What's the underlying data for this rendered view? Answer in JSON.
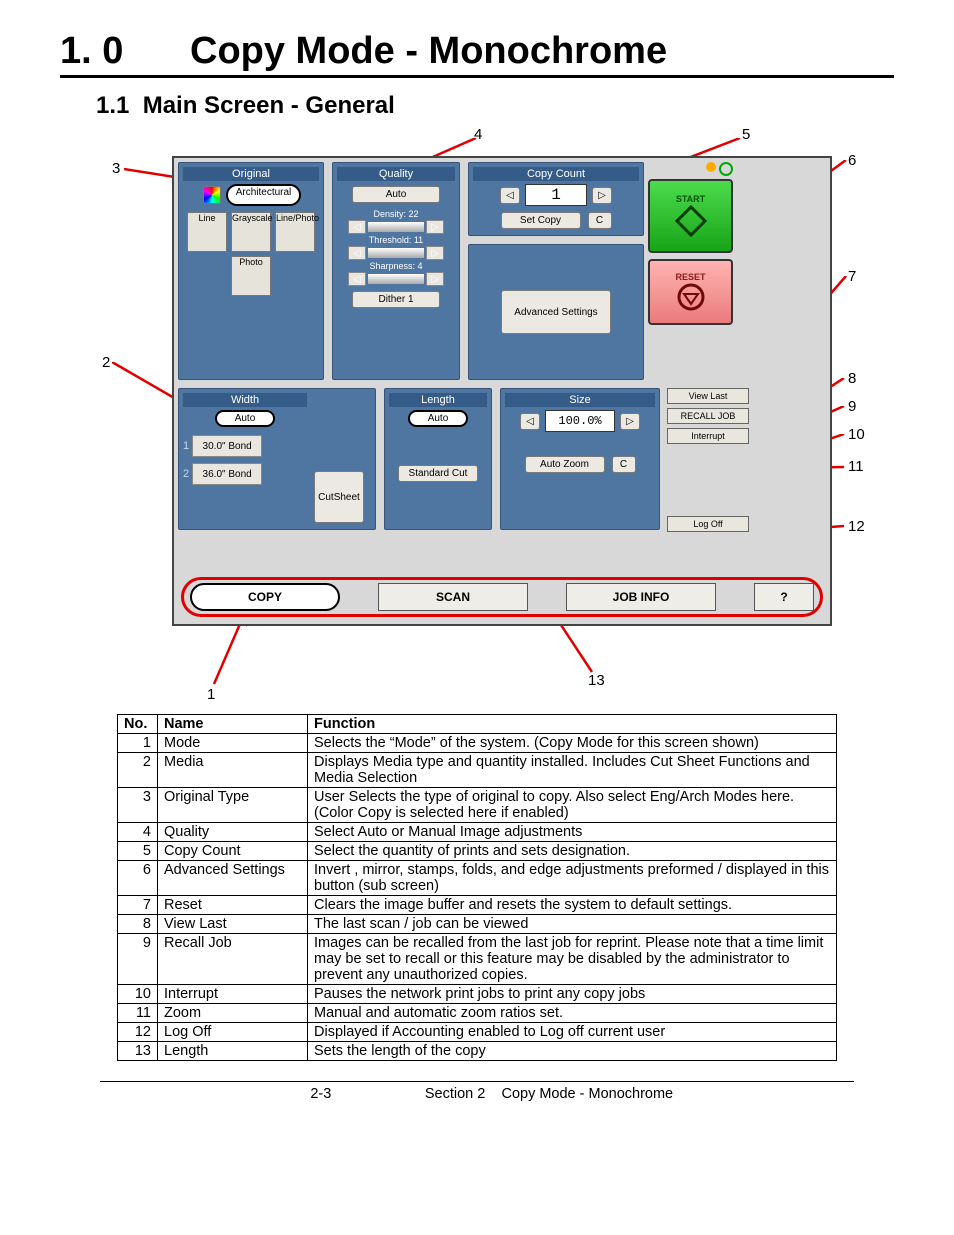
{
  "page": {
    "title_num": "1. 0",
    "title": "Copy Mode - Monochrome",
    "sub_num": "1.1",
    "sub_title": "Main Screen - General",
    "footer_page": "2-3",
    "footer_sec": "Section 2",
    "footer_name": "Copy Mode - Monochrome"
  },
  "callouts": {
    "n1": "1",
    "n2": "2",
    "n3": "3",
    "n4": "4",
    "n5": "5",
    "n6": "6",
    "n7": "7",
    "n8": "8",
    "n9": "9",
    "n10": "10",
    "n11": "11",
    "n12": "12",
    "n13": "13"
  },
  "ui": {
    "original": {
      "title": "Original",
      "arch": "Architectural",
      "m1": "Line",
      "m2": "Grayscale",
      "m3": "Line/Photo",
      "m4": "Photo"
    },
    "quality": {
      "title": "Quality",
      "auto": "Auto",
      "density": "Density: 22",
      "threshold": "Threshold: 11",
      "sharpness": "Sharpness: 4",
      "dither": "Dither 1"
    },
    "copy_count": {
      "title": "Copy Count",
      "value": "1",
      "set": "Set Copy",
      "clear": "C"
    },
    "adv": "Advanced Settings",
    "start": "START",
    "reset": "RESET",
    "side": {
      "viewlast": "View Last",
      "recall": "RECALL JOB",
      "interrupt": "Interrupt",
      "logoff": "Log Off"
    },
    "width": {
      "title": "Width",
      "auto": "Auto",
      "r1": "30.0\" Bond",
      "r2": "36.0\" Bond",
      "r1n": "1",
      "r2n": "2",
      "cut": "CutSheet"
    },
    "length": {
      "title": "Length",
      "auto": "Auto",
      "std": "Standard Cut"
    },
    "size": {
      "title": "Size",
      "val": "100.0%",
      "autozoom": "Auto Zoom",
      "clear": "C"
    },
    "mode": {
      "copy": "COPY",
      "scan": "SCAN",
      "jobinfo": "JOB INFO",
      "help": "?"
    }
  },
  "table": {
    "h_no": "No.",
    "h_name": "Name",
    "h_func": "Function",
    "rows": [
      {
        "no": "1",
        "name": "Mode",
        "func": "Selects the “Mode” of the system. (Copy Mode for this screen shown)"
      },
      {
        "no": "2",
        "name": "Media",
        "func": "Displays Media type and quantity installed. Includes Cut Sheet Functions and Media Selection"
      },
      {
        "no": "3",
        "name": "Original Type",
        "func": "User Selects the type of original to copy. Also select Eng/Arch Modes here. (Color Copy is selected here if enabled)"
      },
      {
        "no": "4",
        "name": "Quality",
        "func": "Select Auto or Manual Image adjustments"
      },
      {
        "no": "5",
        "name": "Copy Count",
        "func": "Select the quantity of prints and sets designation."
      },
      {
        "no": "6",
        "name": "Advanced Settings",
        "func": "Invert , mirror, stamps, folds, and edge adjustments preformed / displayed in this button (sub screen)"
      },
      {
        "no": "7",
        "name": "Reset",
        "func": "Clears the image buffer and resets the system to default settings."
      },
      {
        "no": "8",
        "name": "View Last",
        "func": "The last scan / job can be viewed"
      },
      {
        "no": "9",
        "name": "Recall Job",
        "func": "Images can be recalled from the last job for reprint. Please note that a time limit may be set to recall or this feature may be disabled by the administrator to prevent any unauthorized copies."
      },
      {
        "no": "10",
        "name": "Interrupt",
        "func": "Pauses the network print jobs to print any copy jobs"
      },
      {
        "no": "11",
        "name": "Zoom",
        "func": "Manual and automatic zoom ratios set."
      },
      {
        "no": "12",
        "name": "Log Off",
        "func": "Displayed if Accounting enabled to Log off current user"
      },
      {
        "no": "13",
        "name": "Length",
        "func": "Sets the length of the copy"
      }
    ]
  }
}
